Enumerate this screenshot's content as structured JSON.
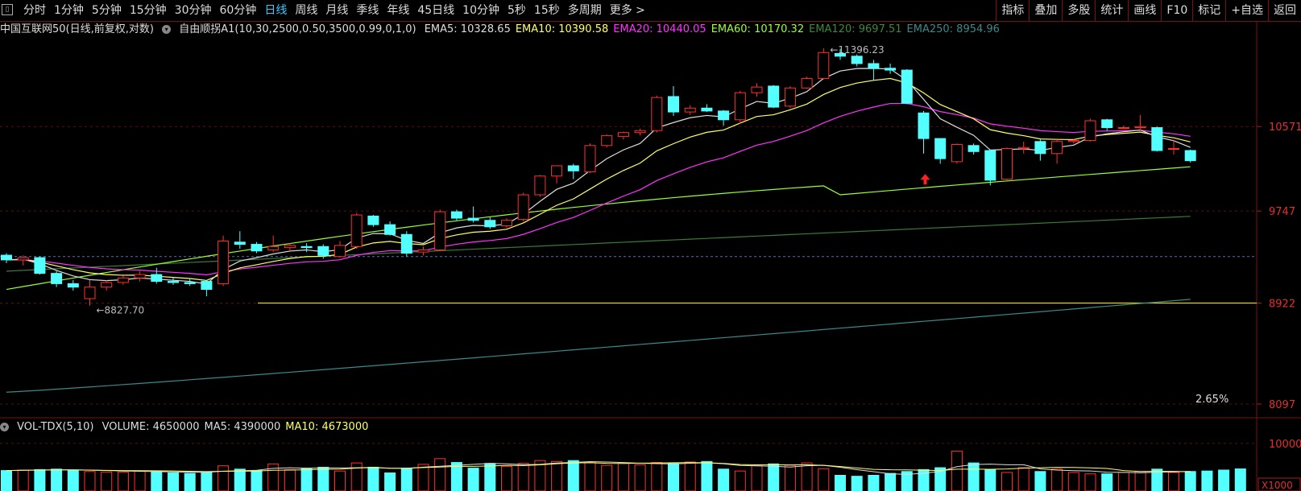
{
  "toolbar": {
    "periods": [
      "分时",
      "1分钟",
      "5分钟",
      "15分钟",
      "30分钟",
      "60分钟",
      "日线",
      "周线",
      "月线",
      "季线",
      "年线",
      "45日线",
      "10分钟",
      "5秒",
      "15秒",
      "多周期",
      "更多 >"
    ],
    "active_period": "日线",
    "tools": [
      "指标",
      "叠加",
      "多股",
      "统计",
      "画线",
      "F10",
      "标记",
      "+自选",
      "返回"
    ]
  },
  "header": {
    "security": "中国互联网50(日线,前复权,对数)",
    "indicator": "自由顺拐A1(10,30,2500,0.50,3500,0.99,0,1,0)",
    "ema_labels": [
      {
        "text": "EMA5: 10328.65",
        "color": "#dddddd"
      },
      {
        "text": "EMA10: 10390.58",
        "color": "#ffff66"
      },
      {
        "text": "EMA20: 10440.05",
        "color": "#ff33ff"
      },
      {
        "text": "EMA60: 10170.32",
        "color": "#99ff33"
      },
      {
        "text": "EMA120: 9697.51",
        "color": "#3a8a3a"
      },
      {
        "text": "EMA250: 8954.96",
        "color": "#3a8a8a"
      }
    ]
  },
  "volume_header": {
    "indicator": "VOL-TDX(5,10)",
    "labels": [
      {
        "text": "VOLUME: 4650000",
        "color": "#dddddd"
      },
      {
        "text": "MA5: 4390000",
        "color": "#dddddd"
      },
      {
        "text": "MA10: 4673000",
        "color": "#ffff66"
      }
    ]
  },
  "chart_data": {
    "type": "candlestick",
    "y_ticks": [
      "10571",
      "9747",
      "8922",
      "8097"
    ],
    "y_range": [
      8097,
      11396.23
    ],
    "high_annotation": "11396.23",
    "low_annotation": "8827.70",
    "percent_label": "2.65%",
    "volume_tick": "10000",
    "volume_unit": "X1000",
    "reference_line": 8922,
    "dashed_line": 9330,
    "candles": [
      {
        "o": 9342,
        "h": 9360,
        "l": 9270,
        "c": 9300
      },
      {
        "o": 9300,
        "h": 9340,
        "l": 9250,
        "c": 9320
      },
      {
        "o": 9320,
        "h": 9330,
        "l": 9170,
        "c": 9180
      },
      {
        "o": 9180,
        "h": 9200,
        "l": 9060,
        "c": 9090
      },
      {
        "o": 9090,
        "h": 9120,
        "l": 9030,
        "c": 9060
      },
      {
        "o": 8960,
        "h": 9120,
        "l": 8900,
        "c": 9060
      },
      {
        "o": 9060,
        "h": 9120,
        "l": 9030,
        "c": 9100
      },
      {
        "o": 9100,
        "h": 9160,
        "l": 9080,
        "c": 9140
      },
      {
        "o": 9140,
        "h": 9200,
        "l": 9110,
        "c": 9170
      },
      {
        "o": 9170,
        "h": 9230,
        "l": 9090,
        "c": 9110
      },
      {
        "o": 9110,
        "h": 9140,
        "l": 9080,
        "c": 9100
      },
      {
        "o": 9100,
        "h": 9130,
        "l": 9070,
        "c": 9090
      },
      {
        "o": 9110,
        "h": 9120,
        "l": 8980,
        "c": 9040
      },
      {
        "o": 9090,
        "h": 9520,
        "l": 9070,
        "c": 9470
      },
      {
        "o": 9460,
        "h": 9560,
        "l": 9400,
        "c": 9440
      },
      {
        "o": 9440,
        "h": 9460,
        "l": 9360,
        "c": 9380
      },
      {
        "o": 9390,
        "h": 9520,
        "l": 9370,
        "c": 9420
      },
      {
        "o": 9410,
        "h": 9450,
        "l": 9380,
        "c": 9430
      },
      {
        "o": 9420,
        "h": 9450,
        "l": 9370,
        "c": 9410
      },
      {
        "o": 9420,
        "h": 9440,
        "l": 9310,
        "c": 9340
      },
      {
        "o": 9330,
        "h": 9470,
        "l": 9320,
        "c": 9430
      },
      {
        "o": 9420,
        "h": 9730,
        "l": 9400,
        "c": 9710
      },
      {
        "o": 9700,
        "h": 9710,
        "l": 9600,
        "c": 9620
      },
      {
        "o": 9620,
        "h": 9650,
        "l": 9520,
        "c": 9530
      },
      {
        "o": 9530,
        "h": 9560,
        "l": 9330,
        "c": 9360
      },
      {
        "o": 9370,
        "h": 9420,
        "l": 9340,
        "c": 9390
      },
      {
        "o": 9390,
        "h": 9760,
        "l": 9380,
        "c": 9740
      },
      {
        "o": 9740,
        "h": 9760,
        "l": 9660,
        "c": 9680
      },
      {
        "o": 9680,
        "h": 9790,
        "l": 9640,
        "c": 9660
      },
      {
        "o": 9660,
        "h": 9690,
        "l": 9580,
        "c": 9600
      },
      {
        "o": 9610,
        "h": 9680,
        "l": 9590,
        "c": 9660
      },
      {
        "o": 9670,
        "h": 9920,
        "l": 9650,
        "c": 9900
      },
      {
        "o": 9900,
        "h": 10090,
        "l": 9880,
        "c": 10080
      },
      {
        "o": 10080,
        "h": 10180,
        "l": 10010,
        "c": 10180
      },
      {
        "o": 10180,
        "h": 10200,
        "l": 10050,
        "c": 10130
      },
      {
        "o": 10120,
        "h": 10400,
        "l": 10110,
        "c": 10380
      },
      {
        "o": 10380,
        "h": 10490,
        "l": 10360,
        "c": 10480
      },
      {
        "o": 10470,
        "h": 10520,
        "l": 10440,
        "c": 10510
      },
      {
        "o": 10510,
        "h": 10550,
        "l": 10480,
        "c": 10530
      },
      {
        "o": 10530,
        "h": 10890,
        "l": 10510,
        "c": 10870
      },
      {
        "o": 10880,
        "h": 10990,
        "l": 10680,
        "c": 10720
      },
      {
        "o": 10720,
        "h": 10790,
        "l": 10690,
        "c": 10760
      },
      {
        "o": 10760,
        "h": 10800,
        "l": 10720,
        "c": 10730
      },
      {
        "o": 10730,
        "h": 10740,
        "l": 10580,
        "c": 10640
      },
      {
        "o": 10640,
        "h": 10940,
        "l": 10600,
        "c": 10920
      },
      {
        "o": 10920,
        "h": 11020,
        "l": 10880,
        "c": 10980
      },
      {
        "o": 10990,
        "h": 11000,
        "l": 10760,
        "c": 10770
      },
      {
        "o": 10780,
        "h": 10990,
        "l": 10760,
        "c": 10970
      },
      {
        "o": 10970,
        "h": 11090,
        "l": 10960,
        "c": 11070
      },
      {
        "o": 11070,
        "h": 11396,
        "l": 11060,
        "c": 11350
      },
      {
        "o": 11340,
        "h": 11390,
        "l": 11270,
        "c": 11310
      },
      {
        "o": 11310,
        "h": 11330,
        "l": 11200,
        "c": 11230
      },
      {
        "o": 11230,
        "h": 11270,
        "l": 11050,
        "c": 11180
      },
      {
        "o": 11180,
        "h": 11230,
        "l": 11120,
        "c": 11160
      },
      {
        "o": 11160,
        "h": 11170,
        "l": 10800,
        "c": 10810
      },
      {
        "o": 10710,
        "h": 10730,
        "l": 10300,
        "c": 10450
      },
      {
        "o": 10450,
        "h": 10450,
        "l": 10200,
        "c": 10250
      },
      {
        "o": 10220,
        "h": 10400,
        "l": 10200,
        "c": 10390
      },
      {
        "o": 10380,
        "h": 10400,
        "l": 10290,
        "c": 10320
      },
      {
        "o": 10330,
        "h": 10340,
        "l": 9990,
        "c": 10040
      },
      {
        "o": 10050,
        "h": 10360,
        "l": 10040,
        "c": 10350
      },
      {
        "o": 10350,
        "h": 10420,
        "l": 10300,
        "c": 10360
      },
      {
        "o": 10420,
        "h": 10440,
        "l": 10230,
        "c": 10300
      },
      {
        "o": 10300,
        "h": 10440,
        "l": 10200,
        "c": 10420
      },
      {
        "o": 10420,
        "h": 10450,
        "l": 10400,
        "c": 10430
      },
      {
        "o": 10430,
        "h": 10650,
        "l": 10420,
        "c": 10630
      },
      {
        "o": 10640,
        "h": 10650,
        "l": 10530,
        "c": 10560
      },
      {
        "o": 10560,
        "h": 10580,
        "l": 10550,
        "c": 10560
      },
      {
        "o": 10560,
        "h": 10690,
        "l": 10530,
        "c": 10570
      },
      {
        "o": 10560,
        "h": 10570,
        "l": 10320,
        "c": 10330
      },
      {
        "o": 10350,
        "h": 10440,
        "l": 10290,
        "c": 10350
      },
      {
        "o": 10330,
        "h": 10340,
        "l": 10210,
        "c": 10230
      }
    ],
    "volume": [
      4300,
      4400,
      4500,
      4600,
      4400,
      4100,
      4000,
      4000,
      4200,
      4100,
      3800,
      3700,
      3900,
      5300,
      4600,
      4300,
      5700,
      4500,
      4800,
      5000,
      4200,
      5900,
      5000,
      3800,
      4800,
      5600,
      6800,
      6000,
      4800,
      5800,
      5200,
      5800,
      6400,
      6200,
      6400,
      6100,
      5400,
      5800,
      5500,
      6000,
      5800,
      6100,
      6200,
      4600,
      4200,
      5300,
      5700,
      5400,
      5900,
      4700,
      3300,
      3100,
      3300,
      3700,
      4100,
      4500,
      4900,
      8400,
      5900,
      4500,
      3900,
      4900,
      4100,
      4600,
      3900,
      3600,
      3600,
      3900,
      4100,
      4600,
      3900,
      4100,
      4200,
      4400,
      4650
    ]
  }
}
